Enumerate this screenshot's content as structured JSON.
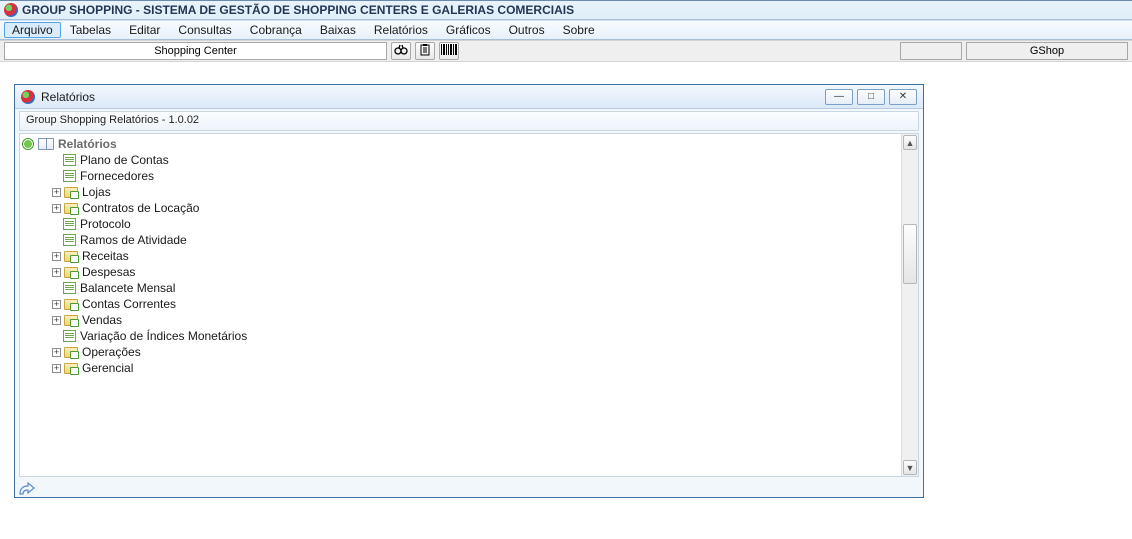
{
  "app": {
    "title": "GROUP SHOPPING - SISTEMA DE GESTÃO DE SHOPPING CENTERS E GALERIAS COMERCIAIS"
  },
  "menu": {
    "items": [
      "Arquivo",
      "Tabelas",
      "Editar",
      "Consultas",
      "Cobrança",
      "Baixas",
      "Relatórios",
      "Gráficos",
      "Outros",
      "Sobre"
    ],
    "active_index": 0
  },
  "toolbar": {
    "shopping_center_label": "Shopping Center",
    "icons": [
      "binoculars",
      "clipboard",
      "barcode"
    ],
    "right1": "",
    "right2": "GShop"
  },
  "child_window": {
    "title": "Relatórios",
    "subtitle": "Group Shopping Relatórios - 1.0.02"
  },
  "tree": {
    "root": "Relatórios",
    "items": [
      {
        "label": "Plano de Contas",
        "expandable": false
      },
      {
        "label": "Fornecedores",
        "expandable": false
      },
      {
        "label": "Lojas",
        "expandable": true
      },
      {
        "label": "Contratos de Locação",
        "expandable": true
      },
      {
        "label": "Protocolo",
        "expandable": false
      },
      {
        "label": "Ramos de Atividade",
        "expandable": false
      },
      {
        "label": "Receitas",
        "expandable": true
      },
      {
        "label": "Despesas",
        "expandable": true
      },
      {
        "label": "Balancete Mensal",
        "expandable": false
      },
      {
        "label": "Contas Correntes",
        "expandable": true
      },
      {
        "label": "Vendas",
        "expandable": true
      },
      {
        "label": "Variação de Índices Monetários",
        "expandable": false
      },
      {
        "label": "Operações",
        "expandable": true
      },
      {
        "label": "Gerencial",
        "expandable": true
      }
    ]
  }
}
